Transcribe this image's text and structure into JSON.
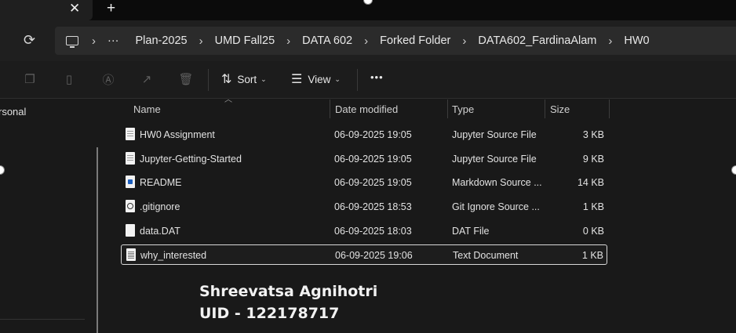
{
  "tabbar": {
    "close_glyph": "✕",
    "new_tab_glyph": "+"
  },
  "address": {
    "refresh_icon": "refresh-icon",
    "more_glyph": "···",
    "crumbs": [
      "Plan-2025",
      "UMD Fall25",
      "DATA 602",
      "Forked Folder",
      "DATA602_FardinaAlam",
      "HW0"
    ]
  },
  "toolbar": {
    "sort_label": "Sort",
    "view_label": "View",
    "more_glyph": "•••"
  },
  "sidebar": {
    "item_label": "rsonal"
  },
  "columns": {
    "name": "Name",
    "date": "Date modified",
    "type": "Type",
    "size": "Size"
  },
  "files": [
    {
      "name": "HW0 Assignment",
      "date": "06-09-2025 19:05",
      "type": "Jupyter Source File",
      "size": "3 KB",
      "icon": "notebook-file-icon"
    },
    {
      "name": "Jupyter-Getting-Started",
      "date": "06-09-2025 19:05",
      "type": "Jupyter Source File",
      "size": "9 KB",
      "icon": "notebook-file-icon"
    },
    {
      "name": "README",
      "date": "06-09-2025 19:05",
      "type": "Markdown Source ...",
      "size": "14 KB",
      "icon": "markdown-file-icon"
    },
    {
      "name": ".gitignore",
      "date": "06-09-2025 18:53",
      "type": "Git Ignore Source ...",
      "size": "1 KB",
      "icon": "gitignore-file-icon"
    },
    {
      "name": "data.DAT",
      "date": "06-09-2025 18:03",
      "type": "DAT File",
      "size": "0 KB",
      "icon": "blank-file-icon"
    },
    {
      "name": "why_interested",
      "date": "06-09-2025 19:06",
      "type": "Text Document",
      "size": "1 KB",
      "icon": "text-file-icon",
      "selected": true
    }
  ],
  "annotation": {
    "line1": "Shreevatsa Agnihotri",
    "line2": "UID - 122178717"
  },
  "colors": {
    "background": "#191919",
    "toolbar": "#1c1c1c",
    "addressbar": "#2b2b2b",
    "selection_border": "#d8d8d8"
  }
}
